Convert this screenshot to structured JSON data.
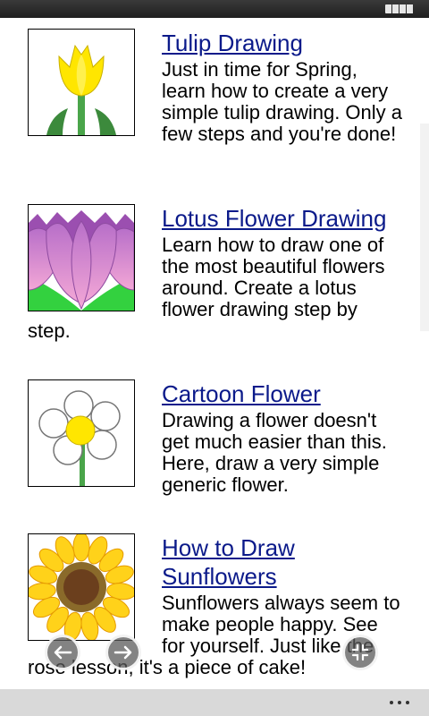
{
  "status": {
    "battery_icon": "battery-icon"
  },
  "articles": [
    {
      "title": "Tulip Drawing",
      "description": "Just in time for Spring, learn how to create a very simple tulip drawing. Only a few steps and you're done!",
      "icon": "tulip-image"
    },
    {
      "title": "Lotus Flower Drawing",
      "description": "Learn how to draw one of the most beautiful flowers around. Create a lotus flower drawing step by step.",
      "icon": "lotus-image"
    },
    {
      "title": "Cartoon Flower",
      "description": "Drawing a flower doesn't get much easier than this. Here, draw a very simple generic flower.",
      "icon": "cartoon-flower-image"
    },
    {
      "title": "How to Draw Sunflowers",
      "description": "Sunflowers always seem to make people happy. See for yourself. Just like the rose lesson, it's a piece of cake!",
      "icon": "sunflower-image"
    }
  ],
  "nav": {
    "back_icon": "arrow-left-icon",
    "forward_icon": "arrow-right-icon",
    "fullscreen_icon": "fullscreen-icon"
  },
  "app_bar": {
    "more_icon": "more-dots-icon"
  },
  "colors": {
    "link": "#0b1a8a",
    "status_bar": "#2a2a2a",
    "app_bar": "#d9d9d9"
  }
}
